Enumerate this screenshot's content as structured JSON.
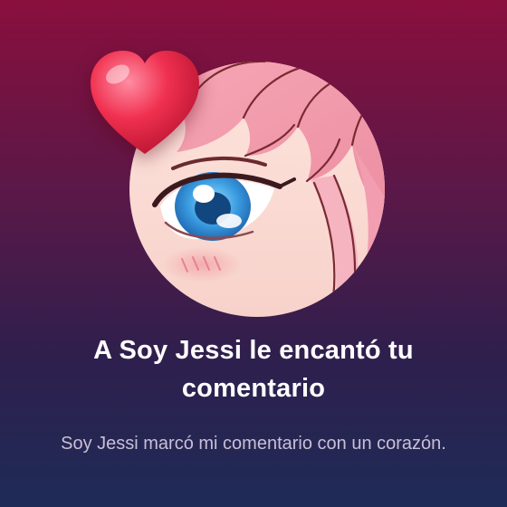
{
  "notification": {
    "title": "A Soy Jessi le encantó tu comentario",
    "message": "Soy Jessi marcó mi comentario con un corazón."
  },
  "avatar_icon": "anime-girl-avatar",
  "reaction_icon": "heart-icon",
  "colors": {
    "background_top": "#8a0f3d",
    "background_bottom": "#1e2b57",
    "heart": "#e8234a",
    "title_text": "#ffffff",
    "message_text": "#c9bfd6"
  }
}
